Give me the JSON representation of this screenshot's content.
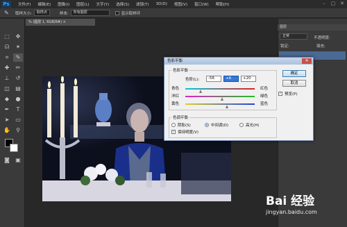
{
  "app": {
    "logo": "Ps"
  },
  "menu": [
    "文件(F)",
    "编辑(E)",
    "图像(I)",
    "图层(L)",
    "文字(Y)",
    "选择(S)",
    "滤镜(T)",
    "3D(D)",
    "视图(V)",
    "窗口(W)",
    "帮助(H)"
  ],
  "window_controls": [
    "–",
    "▢",
    "✕"
  ],
  "options_bar": {
    "sample_size_label": "取样大小:",
    "sample_size_value": "取样点",
    "sample_label": "样本:",
    "sample_value": "所有图层",
    "show_ring_label": "显示取样环"
  },
  "document": {
    "tab_label": "% (图层 1, RGB/8#) ×"
  },
  "right_panel": {
    "header": "图层",
    "blend_mode": "正常",
    "opacity_label": "不透明度:",
    "lock_label": "锁定:",
    "fill_label": "填充:"
  },
  "dialog": {
    "title": "色彩平衡",
    "color_balance_group": "色彩平衡",
    "levels_label": "色阶(L):",
    "levels": [
      "-56",
      "+6",
      "+20"
    ],
    "sliders": [
      {
        "left": "青色",
        "right": "红色",
        "value": -56
      },
      {
        "left": "洋红",
        "right": "绿色",
        "value": 6
      },
      {
        "left": "黄色",
        "right": "蓝色",
        "value": 20
      }
    ],
    "tone_group": "色调平衡",
    "tones": [
      "阴影(S)",
      "中间调(D)",
      "高光(H)"
    ],
    "selected_tone": "中间调(D)",
    "preserve_label": "保持明度(V)",
    "preserve_checked": true,
    "ok_label": "确定",
    "cancel_label": "取消",
    "preview_label": "预览(P)",
    "preview_checked": true
  },
  "watermark": {
    "main": "Bai 经验",
    "sub": "jingyan.baidu.com"
  }
}
